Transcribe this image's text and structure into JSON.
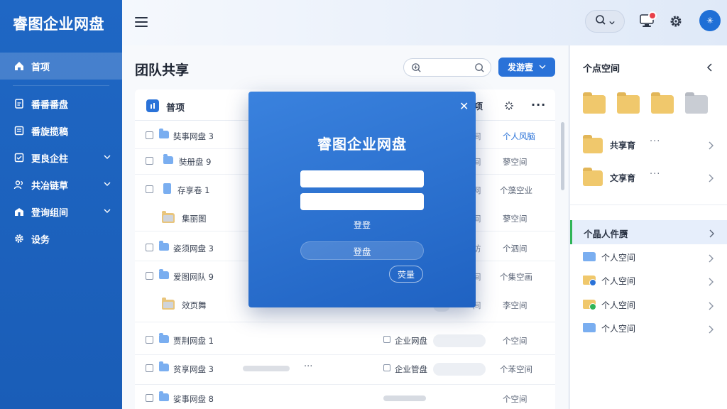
{
  "app": {
    "title": "睿图企业网盘"
  },
  "sidebar": {
    "items": [
      {
        "label": "首项",
        "icon": "home-icon"
      },
      {
        "label": "番番番盘",
        "icon": "document-icon"
      },
      {
        "label": "番旋揽稿",
        "icon": "list-icon"
      },
      {
        "label": "更良企柱",
        "icon": "checklist-icon",
        "expandable": true
      },
      {
        "label": "共冶链草",
        "icon": "users-icon",
        "expandable": true
      },
      {
        "label": "登询组间",
        "icon": "building-icon",
        "expandable": true
      },
      {
        "label": "设务",
        "icon": "gear-icon"
      }
    ]
  },
  "header": {
    "menu_icon": "hamburger-icon",
    "search_icon": "search-icon",
    "notification_icon": "monitor-icon",
    "settings_icon": "gear-icon",
    "avatar_text": "✳"
  },
  "main": {
    "title": "团队共享",
    "search_placeholder": "",
    "primary_button": "发游壹",
    "table": {
      "header_label": "普项",
      "header_right": "项",
      "rows": [
        {
          "name": "奘事网盘 3",
          "col3": "个人风脑",
          "link": true,
          "type": "folder"
        },
        {
          "name": "奘册盘 9",
          "col3": "蓼空间",
          "type": "folder"
        },
        {
          "name": "存享卷 1",
          "col3": "个藻空业",
          "type": "doc"
        },
        {
          "name": "集丽图",
          "col3": "蓼空间",
          "type": "bigfolder"
        },
        {
          "name": "姿须网盘 3",
          "col3": "个泗间",
          "type": "folder"
        },
        {
          "name": "爱图网队 9",
          "col3": "个集空画",
          "type": "folder"
        },
        {
          "name": "效页舞",
          "col3": "李空间",
          "type": "bigfolder"
        },
        {
          "name": "贾荆网盘 1",
          "col2": "企业网盘",
          "col3": "个空间",
          "type": "folder"
        },
        {
          "name": "贫享网盘 3",
          "col2": "企业管盘",
          "col3": "个苯空间",
          "type": "folder"
        },
        {
          "name": "娑事网盘 8",
          "col3": "个空间",
          "type": "folder"
        }
      ],
      "partial_col3": [
        "间",
        "间",
        "网",
        "间",
        "访",
        "间",
        "间"
      ]
    }
  },
  "right_panel": {
    "title": "个点空间",
    "items": [
      {
        "label": "共享育"
      },
      {
        "label": "文享育"
      }
    ],
    "selected": "个晶人件赝",
    "sub_items": [
      {
        "label": "个人空间",
        "color": "blue",
        "badge": ""
      },
      {
        "label": "个人空间",
        "color": "yellow",
        "badge": "#2a72d8"
      },
      {
        "label": "个人空间",
        "color": "yellow",
        "badge": "#2fb457"
      },
      {
        "label": "个人空间",
        "color": "blue",
        "badge": ""
      }
    ]
  },
  "modal": {
    "title": "睿图企业网盘",
    "username_value": "",
    "password_value": "",
    "link_text": "登登",
    "submit_button": "登盘",
    "secondary_button": "荧量"
  },
  "colors": {
    "brand": "#1f67c4",
    "accent": "#2a72d8",
    "green": "#2fb457",
    "badge_red": "#e8404a"
  }
}
